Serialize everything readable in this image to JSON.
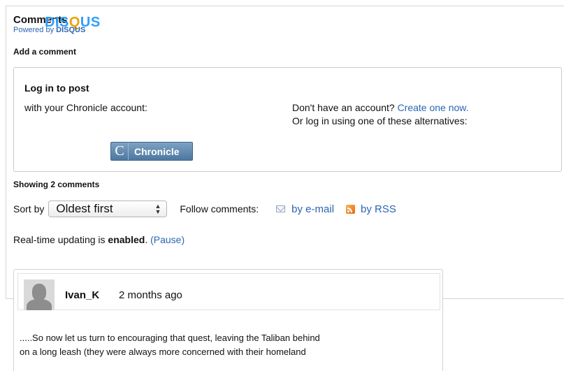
{
  "header": {
    "title": "Comments",
    "logo_text_a": "DIS",
    "logo_text_q": "Q",
    "logo_text_b": "US",
    "powered_prefix": "Powered by",
    "powered_brand": "DISQUS",
    "add_comment": "Add a comment"
  },
  "login": {
    "title": "Log in to post",
    "with_account": "with your Chronicle account:",
    "no_account": "Don't have an account?",
    "create_link": "Create one now.",
    "alternatives": "Or log in using one of these alternatives:",
    "button_icon_letter": "C",
    "button_label": "Chronicle"
  },
  "comments_bar": {
    "showing": "Showing 2 comments",
    "sort_label": "Sort by",
    "sort_value": "Oldest first",
    "follow_label": "Follow comments:",
    "by_email": "by e-mail",
    "by_rss": "by RSS"
  },
  "realtime": {
    "prefix": "Real-time updating is",
    "state": "enabled",
    "suffix": ".",
    "pause": "(Pause)"
  },
  "comments": [
    {
      "author": "Ivan_K",
      "time": "2 months ago",
      "line1": ".....So now let us turn to encouraging that quest, leaving the Taliban behind",
      "line2": "on a long leash (they were always more concerned with their homeland"
    }
  ],
  "colors": {
    "link": "#2a66b2",
    "disqus_blue": "#2e9fff",
    "disqus_orange": "#f1a10b",
    "button": "#4d77a0"
  }
}
